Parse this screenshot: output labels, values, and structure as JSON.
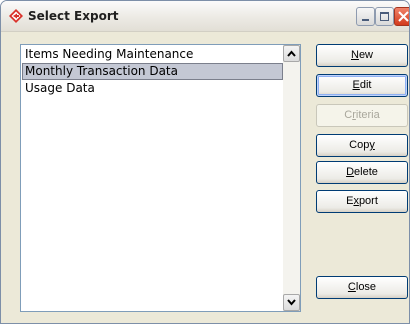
{
  "window": {
    "title": "Select Export",
    "app_icon": "diamond-arrow-icon",
    "minimize_icon": "minimize-icon",
    "maximize_icon": "maximize-icon",
    "close_icon": "close-icon",
    "close_color": "#d33a1c"
  },
  "exports_list": {
    "items": [
      {
        "label": "Items Needing Maintenance",
        "selected": false
      },
      {
        "label": "Monthly Transaction Data",
        "selected": true
      },
      {
        "label": "Usage Data",
        "selected": false
      }
    ],
    "selection_color": "#c4c8d4"
  },
  "buttons": {
    "new": {
      "pre": "",
      "key": "N",
      "post": "ew"
    },
    "edit": {
      "pre": "",
      "key": "E",
      "post": "dit"
    },
    "criteria": {
      "pre": "C",
      "key": "r",
      "post": "iteria",
      "disabled": true
    },
    "copy": {
      "pre": "Cop",
      "key": "y",
      "post": ""
    },
    "delete": {
      "pre": "",
      "key": "D",
      "post": "elete"
    },
    "export": {
      "pre": "E",
      "key": "x",
      "post": "port"
    },
    "close": {
      "pre": "",
      "key": "C",
      "post": "lose"
    }
  }
}
